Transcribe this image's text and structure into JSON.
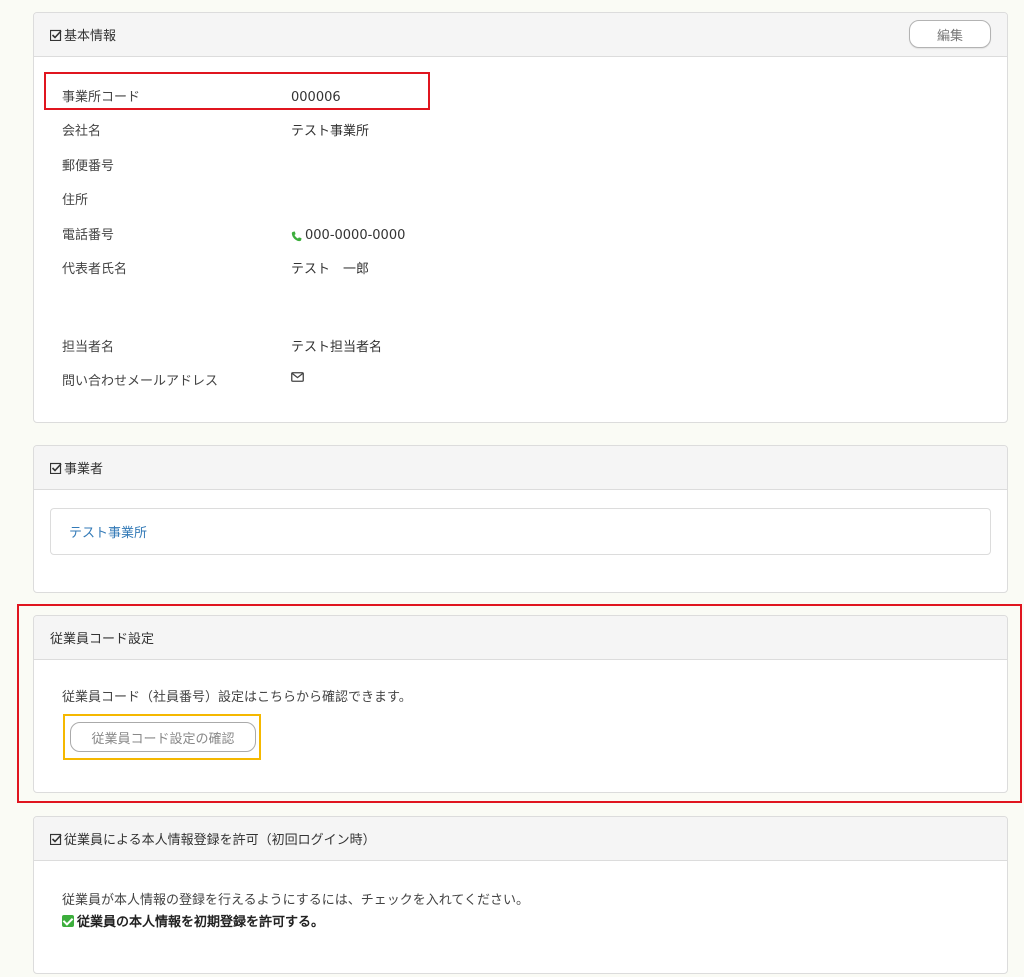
{
  "basic_info": {
    "title": "基本情報",
    "edit_label": "編集",
    "fields": [
      {
        "label": "事業所コード",
        "value": "000006"
      },
      {
        "label": "会社名",
        "value": "テスト事業所"
      },
      {
        "label": "郵便番号",
        "value": ""
      },
      {
        "label": "住所",
        "value": ""
      },
      {
        "label": "電話番号",
        "value": "000-0000-0000"
      },
      {
        "label": "代表者氏名",
        "value": "テスト　一郎"
      },
      {
        "label": "担当者名",
        "value": "テスト担当者名"
      },
      {
        "label": "問い合わせメールアドレス",
        "value": ""
      }
    ]
  },
  "business_owner": {
    "title": "事業者",
    "link_label": "テスト事業所"
  },
  "employee_code": {
    "title": "従業員コード設定",
    "description": "従業員コード（社員番号）設定はこちらから確認できます。",
    "button_label": "従業員コード設定の確認"
  },
  "self_registration": {
    "title": "従業員による本人情報登録を許可（初回ログイン時）",
    "description": "従業員が本人情報の登録を行えるようにするには、チェックを入れてください。",
    "checkbox_label": "従業員の本人情報を初期登録を許可する。",
    "checked": true
  },
  "colors": {
    "highlight_red": "#e0151f",
    "highlight_yellow": "#f5b800",
    "phone_icon_green": "#3cae3c",
    "link_blue": "#337ab7"
  }
}
